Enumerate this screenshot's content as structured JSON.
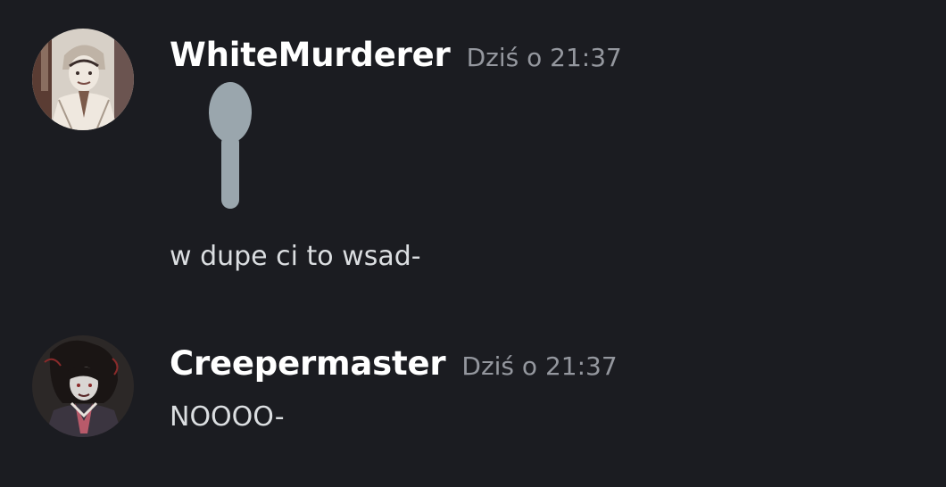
{
  "messages": [
    {
      "username": "WhiteMurderer",
      "timestamp": "Dziś o 21:37",
      "emoji": "spoon-icon",
      "text": "w dupe ci to wsad-"
    },
    {
      "username": "Creepermaster",
      "timestamp": "Dziś o 21:37",
      "text": "NOOOO-"
    }
  ],
  "colors": {
    "background": "#1b1c21",
    "username": "#ffffff",
    "timestamp": "#94979e",
    "message_text": "#dbdee1",
    "spoon": "#9aa6ad"
  }
}
